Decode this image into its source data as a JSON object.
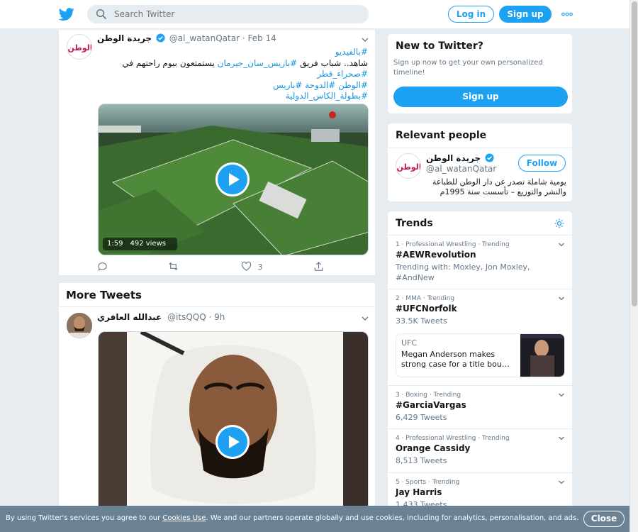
{
  "header": {
    "search_placeholder": "Search Twitter",
    "login_label": "Log in",
    "signup_label": "Sign up"
  },
  "tweet": {
    "author_name": "جريدة الوطن",
    "author_handle": "@al_watanQatar",
    "time": "· Feb 14",
    "lines": [
      {
        "pre": "",
        "tag": "#بالفيديو",
        "post": ""
      },
      {
        "pre": "شاهد.. شباب فريق ",
        "tag": "#باريس_سان_جيرمان",
        "post": " يستمتعون بيوم راحتهم في"
      },
      {
        "pre": "",
        "tag": "#صحراء_قطر",
        "post": ""
      },
      {
        "pre": "",
        "tag": "#الوطن #الدوحة #باريس",
        "post": ""
      },
      {
        "pre": "",
        "tag": "#بطولة_الكاس_الدولية",
        "post": ""
      }
    ],
    "video": {
      "duration": "1:59",
      "views": "492 views"
    },
    "like_count": "3",
    "avatar_text": "الوطن"
  },
  "more_tweets": {
    "title": "More Tweets",
    "tweet": {
      "author_name": "عبدالله العافري",
      "author_handle": "@itsQQQ",
      "time": "· 9h"
    }
  },
  "sidebar": {
    "new_to_twitter": {
      "title": "New to Twitter?",
      "text": "Sign up now to get your own personalized timeline!",
      "button": "Sign up"
    },
    "relevant_people": {
      "title": "Relevant people",
      "name": "جريدة الوطن",
      "handle": "@al_watanQatar",
      "follow_label": "Follow",
      "bio": "يومية شاملة تصدر عن دار الوطن للطباعة والنشر والتوزيع – تأسست سنة 1995م"
    },
    "trends": {
      "title": "Trends",
      "items": [
        {
          "meta": "1 · Professional Wrestling · Trending",
          "name": "#AEWRevolution",
          "sub": "Trending with: Moxley, Jon Moxley, #AndNew"
        },
        {
          "meta": "2 · MMA · Trending",
          "name": "#UFCNorfolk",
          "sub": "33.5K Tweets",
          "news": {
            "source": "UFC",
            "headline": "Megan Anderson makes strong case for a title bou…"
          }
        },
        {
          "meta": "3 · Boxing · Trending",
          "name": "#GarciaVargas",
          "sub": "6,429 Tweets"
        },
        {
          "meta": "4 · Professional Wrestling · Trending",
          "name": "Orange Cassidy",
          "sub": "8,513 Tweets"
        },
        {
          "meta": "5 · Sports · Trending",
          "name": "Jay Harris",
          "sub": "1,433 Tweets"
        }
      ]
    }
  },
  "cookie_bar": {
    "text_before": "By using Twitter's services you agree to our ",
    "link": "Cookies Use",
    "text_after": ". We and our partners operate globally and use cookies, including for analytics, personalisation, and ads.",
    "close_label": "Close"
  },
  "colors": {
    "brand": "#1da1f2",
    "hashtag": "#1b95e0",
    "muted": "#657786",
    "background": "#e6ecf0",
    "cookie_bar": "#6b8194"
  }
}
